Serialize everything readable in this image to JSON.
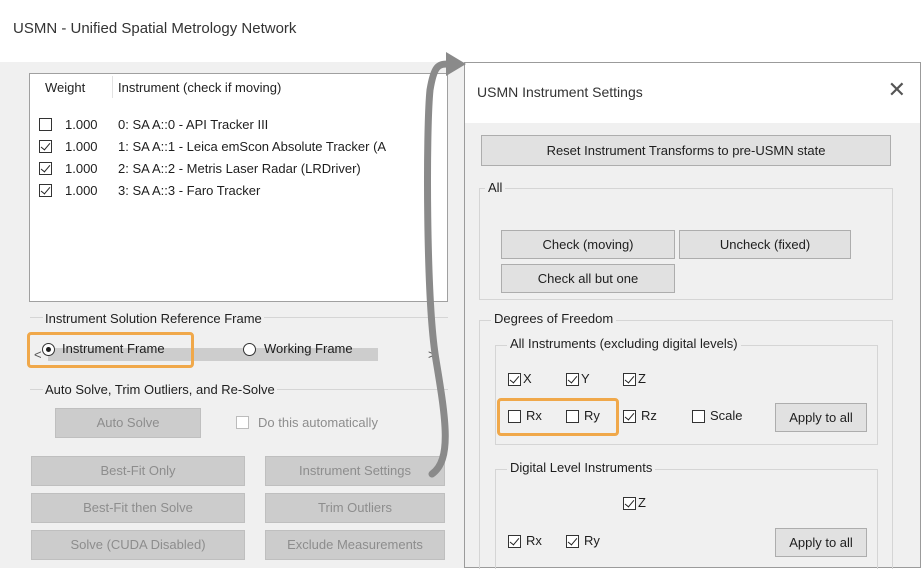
{
  "main_window": {
    "title": "USMN - Unified Spatial Metrology Network",
    "list": {
      "headers": {
        "weight": "Weight",
        "instrument": "Instrument (check if moving)"
      },
      "rows": [
        {
          "checked": false,
          "weight": "1.000",
          "name": "0: SA A::0 - API Tracker III"
        },
        {
          "checked": true,
          "weight": "1.000",
          "name": "1: SA A::1 - Leica emScon Absolute Tracker (A"
        },
        {
          "checked": true,
          "weight": "1.000",
          "name": "2: SA A::2 - Metris Laser Radar (LRDriver)"
        },
        {
          "checked": true,
          "weight": "1.000",
          "name": "3: SA A::3 - Faro Tracker"
        }
      ]
    },
    "reference_frame": {
      "label": "Instrument Solution Reference Frame",
      "instrument_frame": "Instrument Frame",
      "working_frame": "Working Frame",
      "selected": "instrument_frame"
    },
    "auto_solve": {
      "label": "Auto Solve, Trim Outliers, and Re-Solve",
      "button": "Auto Solve",
      "checkbox": "Do this automatically"
    },
    "buttons": {
      "best_fit_only": "Best-Fit Only",
      "instrument_settings": "Instrument Settings",
      "best_fit_then_solve": "Best-Fit then Solve",
      "trim_outliers": "Trim Outliers",
      "solve_cuda": "Solve (CUDA Disabled)",
      "exclude_measurements": "Exclude Measurements"
    }
  },
  "dialog": {
    "title": "USMN Instrument Settings",
    "close_glyph": "✕",
    "reset_button": "Reset Instrument Transforms to pre-USMN state",
    "all_group": {
      "label": "All",
      "check_moving": "Check (moving)",
      "uncheck_fixed": "Uncheck (fixed)",
      "check_all_but_one": "Check all but one"
    },
    "dof": {
      "label": "Degrees of Freedom",
      "all_instruments": {
        "label": "All Instruments (excluding digital levels)",
        "x": {
          "label": "X",
          "checked": true
        },
        "y": {
          "label": "Y",
          "checked": true
        },
        "z": {
          "label": "Z",
          "checked": true
        },
        "rx": {
          "label": "Rx",
          "checked": false
        },
        "ry": {
          "label": "Ry",
          "checked": false
        },
        "rz": {
          "label": "Rz",
          "checked": true
        },
        "scale": {
          "label": "Scale",
          "checked": false
        },
        "apply": "Apply to all"
      },
      "digital_level": {
        "label": "Digital Level Instruments",
        "z": {
          "label": "Z",
          "checked": true
        },
        "rx": {
          "label": "Rx",
          "checked": true
        },
        "ry": {
          "label": "Ry",
          "checked": true
        },
        "apply": "Apply to all"
      }
    }
  },
  "scroll": {
    "left_arrow": "<",
    "right_arrow": ">"
  },
  "colors": {
    "highlight": "#f0a84a",
    "connector": "#8a8a8a"
  }
}
